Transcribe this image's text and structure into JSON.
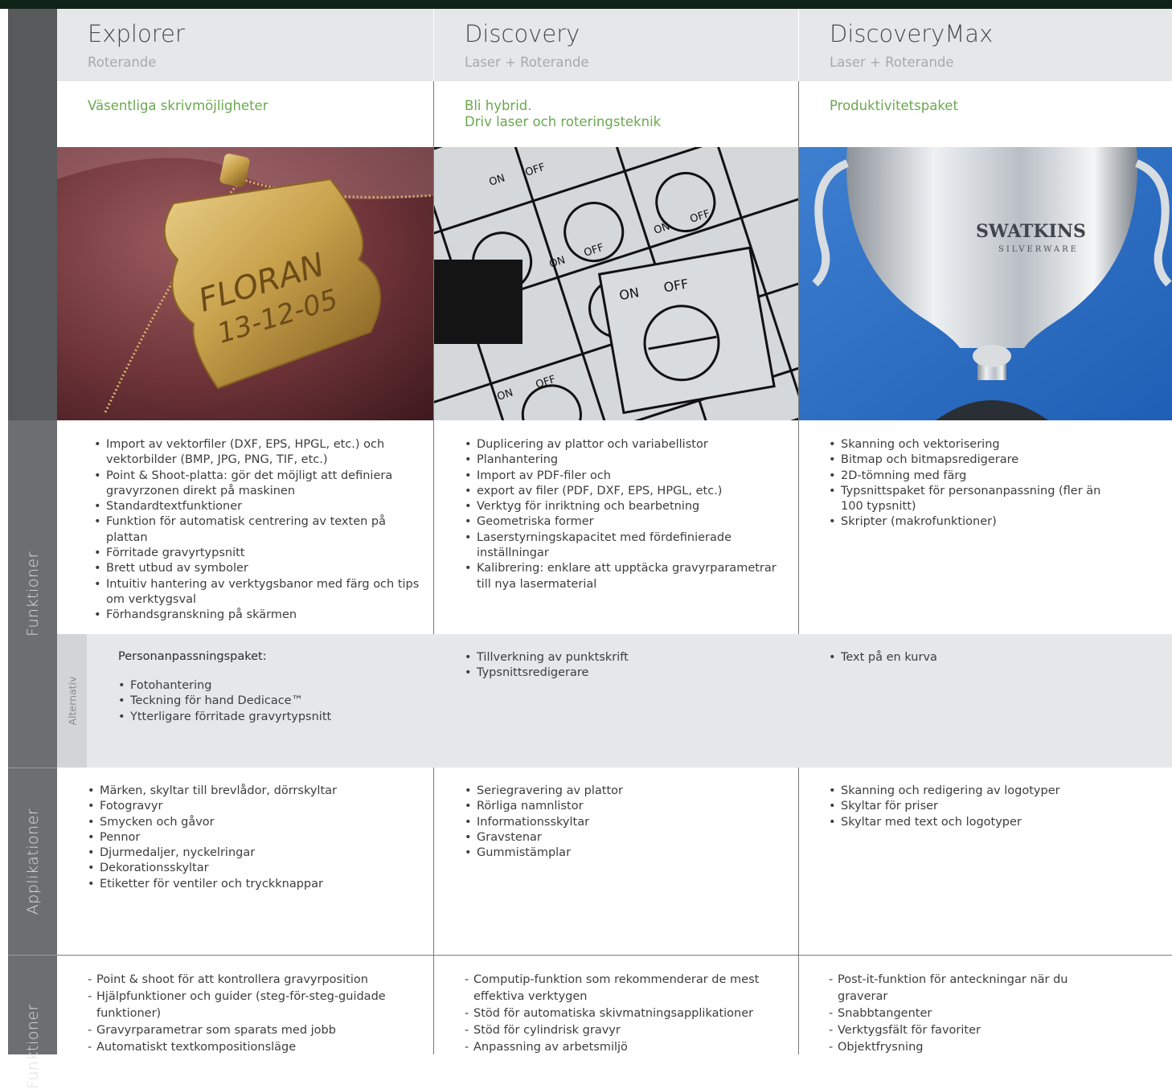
{
  "side_labels": {
    "funktioner": "Funktioner",
    "applikationer": "Applikationer",
    "bottom": "Funktioner",
    "alternativ": "Alternativ"
  },
  "columns": [
    {
      "name": "Explorer",
      "subtitle": "Roterande",
      "tagline": [
        "Väsentliga skrivmöjligheter"
      ],
      "photo": {
        "description_icon": "engraved-gold-tag-photo",
        "text_line1": "FLORAN",
        "text_line2": "13-12-05"
      },
      "features": [
        "Import av vektorfiler (DXF, EPS, HPGL, etc.) och vektorbilder (BMP, JPG, PNG, TIF, etc.)",
        "Point & Shoot-platta: gör det möjligt att definiera gravyrzonen direkt på maskinen",
        "Standardtextfunktioner",
        "Funktion för automatisk centrering av texten på plattan",
        "Förritade gravyrtypsnitt",
        "Brett utbud av symboler",
        "Intuitiv hantering av verktygsbanor med färg och tips om verktygsval",
        "Förhandsgranskning på skärmen"
      ],
      "options_title": "Personanpassningspaket:",
      "options": [
        "Fotohantering",
        "Teckning för hand Dedicace™",
        "Ytterligare förritade gravyrtypsnitt"
      ],
      "applications": [
        "Märken, skyltar till brevlådor, dörrskyltar",
        "Fotogravyr",
        "Smycken och gåvor",
        "Pennor",
        "Djurmedaljer, nyckelringar",
        "Dekorationsskyltar",
        "Etiketter för ventiler och tryckknappar"
      ],
      "extras": [
        "Point & shoot för att kontrollera gravyrposition",
        "Hjälpfunktioner och guider (steg-för-steg-guidade funktioner)",
        "Gravyrparametrar som sparats med jobb",
        "Automatiskt textkompositionsläge"
      ]
    },
    {
      "name": "Discovery",
      "subtitle": "Laser + Roterande",
      "tagline": [
        "Bli hybrid.",
        "Driv laser och roteringsteknik"
      ],
      "photo": {
        "description_icon": "on-off-engraved-panel-photo",
        "on": "ON",
        "off": "OFF"
      },
      "features": [
        "Duplicering av plattor och variabellistor",
        "Planhantering",
        "Import av PDF-filer och",
        "export av filer (PDF, DXF, EPS, HPGL, etc.)",
        "Verktyg för inriktning och bearbetning",
        "Geometriska former",
        "Laserstyrningskapacitet med fördefinierade inställningar",
        "Kalibrering: enklare att upptäcka gravyrparametrar till nya lasermaterial"
      ],
      "options_title": "",
      "options": [
        "Tillverkning av punktskrift",
        "Typsnittsredigerare"
      ],
      "applications": [
        "Seriegravering av plattor",
        "Rörliga namnlistor",
        "Informationsskyltar",
        "Gravstenar",
        "Gummistämplar"
      ],
      "extras": [
        "Computip-funktion som rekommenderar de mest effektiva verktygen",
        "Stöd för automatiska skivmatningsapplikationer",
        "Stöd för cylindrisk gravyr",
        "Anpassning av arbetsmiljö"
      ]
    },
    {
      "name": "DiscoveryMax",
      "subtitle": "Laser + Roterande",
      "tagline": [
        "Produktivitetspaket"
      ],
      "photo": {
        "description_icon": "silver-trophy-cup-photo",
        "brand_text": "SWATKINS",
        "brand_sub": "SILVERWARE"
      },
      "features": [
        "Skanning och vektorisering",
        "Bitmap och bitmapsredigerare",
        "2D-tömning med färg",
        "Typsnittspaket för personanpassning (fler än 100 typsnitt)",
        "Skripter (makrofunktioner)"
      ],
      "options_title": "",
      "options": [
        "Text på en kurva"
      ],
      "applications": [
        "Skanning och redigering av logotyper",
        "Skyltar för priser",
        "Skyltar med text och logotyper"
      ],
      "extras": [
        "Post-it-funktion för anteckningar när du graverar",
        "Snabbtangenter",
        "Verktygsfält för favoriter",
        "Objektfrysning"
      ]
    }
  ]
}
